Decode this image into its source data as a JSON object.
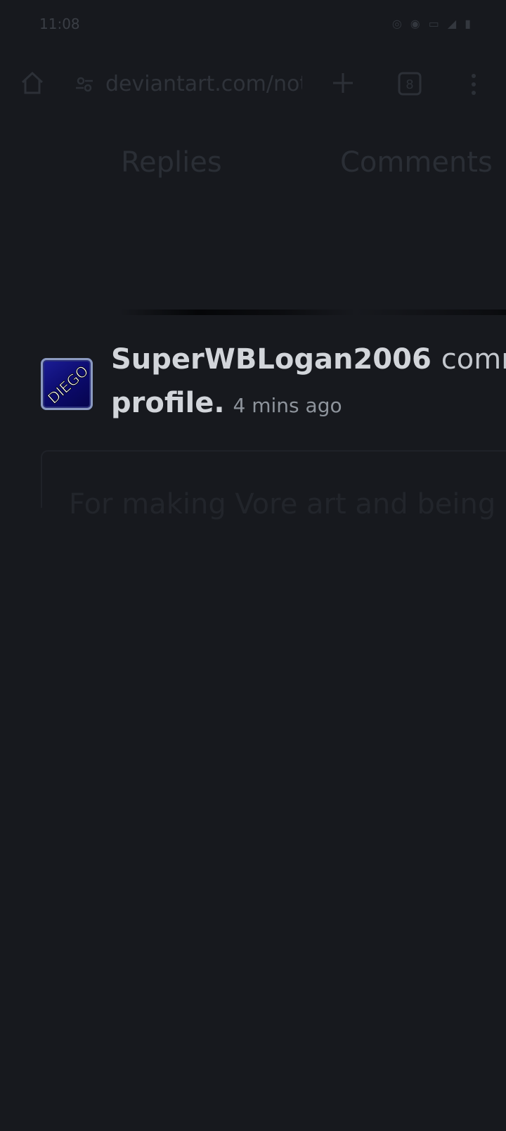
{
  "status_bar": {
    "time": "11:08"
  },
  "browser": {
    "url": "deviantart.com/noti",
    "icons": [
      "home-icon",
      "site-info-icon",
      "new-tab-icon",
      "tab-switcher-icon",
      "menu-icon"
    ]
  },
  "tabs": [
    {
      "label": "Replies"
    },
    {
      "label": "Comments"
    }
  ],
  "notification": {
    "avatar_text": "DIEGO",
    "username": "SuperWBLogan2006",
    "action": "comm",
    "target": "profile",
    "target_suffix": ".",
    "time_ago": "4 mins ago"
  },
  "comment": {
    "text": "For making Vore art and being n"
  },
  "colors": {
    "background": "#17191e",
    "avatar_bg": "#0b0a6a"
  }
}
